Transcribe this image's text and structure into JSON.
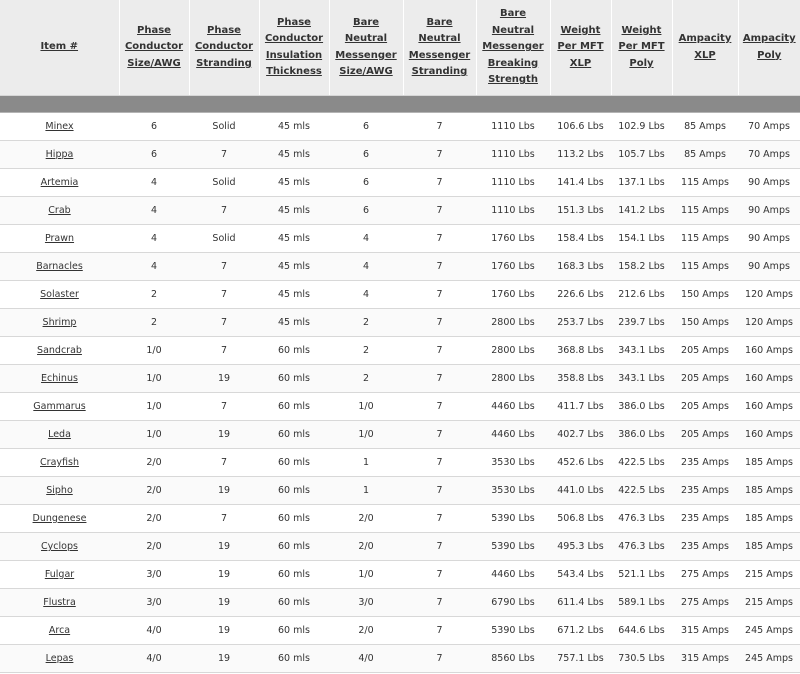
{
  "headers": [
    {
      "key": "item",
      "label": "Item #"
    },
    {
      "key": "p_size",
      "label": "Phase Conductor Size/AWG"
    },
    {
      "key": "p_strand",
      "label": "Phase Conductor Stranding"
    },
    {
      "key": "p_ins",
      "label": "Phase Conductor Insulation Thickness"
    },
    {
      "key": "n_size",
      "label": "Bare Neutral Messenger Size/AWG"
    },
    {
      "key": "n_strand",
      "label": "Bare Neutral Messenger Stranding"
    },
    {
      "key": "n_break",
      "label": "Bare Neutral Messenger Breaking Strength"
    },
    {
      "key": "w_xlp",
      "label": "Weight Per MFT XLP"
    },
    {
      "key": "w_poly",
      "label": "Weight Per MFT Poly"
    },
    {
      "key": "a_xlp",
      "label": "Ampacity XLP"
    },
    {
      "key": "a_poly",
      "label": "Ampacity Poly"
    }
  ],
  "rows": [
    [
      "Minex",
      "6",
      "Solid",
      "45 mls",
      "6",
      "7",
      "1110 Lbs",
      "106.6 Lbs",
      "102.9 Lbs",
      "85 Amps",
      "70 Amps"
    ],
    [
      "Hippa",
      "6",
      "7",
      "45 mls",
      "6",
      "7",
      "1110 Lbs",
      "113.2 Lbs",
      "105.7 Lbs",
      "85 Amps",
      "70 Amps"
    ],
    [
      "Artemia",
      "4",
      "Solid",
      "45 mls",
      "6",
      "7",
      "1110 Lbs",
      "141.4 Lbs",
      "137.1 Lbs",
      "115 Amps",
      "90 Amps"
    ],
    [
      "Crab",
      "4",
      "7",
      "45 mls",
      "6",
      "7",
      "1110 Lbs",
      "151.3 Lbs",
      "141.2 Lbs",
      "115 Amps",
      "90 Amps"
    ],
    [
      "Prawn",
      "4",
      "Solid",
      "45 mls",
      "4",
      "7",
      "1760 Lbs",
      "158.4 Lbs",
      "154.1 Lbs",
      "115 Amps",
      "90 Amps"
    ],
    [
      "Barnacles",
      "4",
      "7",
      "45 mls",
      "4",
      "7",
      "1760 Lbs",
      "168.3 Lbs",
      "158.2 Lbs",
      "115 Amps",
      "90 Amps"
    ],
    [
      "Solaster",
      "2",
      "7",
      "45 mls",
      "4",
      "7",
      "1760 Lbs",
      "226.6 Lbs",
      "212.6 Lbs",
      "150 Amps",
      "120 Amps"
    ],
    [
      "Shrimp",
      "2",
      "7",
      "45 mls",
      "2",
      "7",
      "2800 Lbs",
      "253.7 Lbs",
      "239.7 Lbs",
      "150 Amps",
      "120 Amps"
    ],
    [
      "Sandcrab",
      "1/0",
      "7",
      "60 mls",
      "2",
      "7",
      "2800 Lbs",
      "368.8 Lbs",
      "343.1 Lbs",
      "205 Amps",
      "160 Amps"
    ],
    [
      "Echinus",
      "1/0",
      "19",
      "60 mls",
      "2",
      "7",
      "2800 Lbs",
      "358.8 Lbs",
      "343.1 Lbs",
      "205 Amps",
      "160 Amps"
    ],
    [
      "Gammarus",
      "1/0",
      "7",
      "60 mls",
      "1/0",
      "7",
      "4460 Lbs",
      "411.7 Lbs",
      "386.0 Lbs",
      "205 Amps",
      "160 Amps"
    ],
    [
      "Leda",
      "1/0",
      "19",
      "60 mls",
      "1/0",
      "7",
      "4460 Lbs",
      "402.7 Lbs",
      "386.0 Lbs",
      "205 Amps",
      "160 Amps"
    ],
    [
      "Crayfish",
      "2/0",
      "7",
      "60 mls",
      "1",
      "7",
      "3530 Lbs",
      "452.6 Lbs",
      "422.5 Lbs",
      "235 Amps",
      "185 Amps"
    ],
    [
      "Sipho",
      "2/0",
      "19",
      "60 mls",
      "1",
      "7",
      "3530 Lbs",
      "441.0 Lbs",
      "422.5 Lbs",
      "235 Amps",
      "185 Amps"
    ],
    [
      "Dungenese",
      "2/0",
      "7",
      "60 mls",
      "2/0",
      "7",
      "5390 Lbs",
      "506.8 Lbs",
      "476.3 Lbs",
      "235 Amps",
      "185 Amps"
    ],
    [
      "Cyclops",
      "2/0",
      "19",
      "60 mls",
      "2/0",
      "7",
      "5390 Lbs",
      "495.3 Lbs",
      "476.3 Lbs",
      "235 Amps",
      "185 Amps"
    ],
    [
      "Fulgar",
      "3/0",
      "19",
      "60 mls",
      "1/0",
      "7",
      "4460 Lbs",
      "543.4 Lbs",
      "521.1 Lbs",
      "275 Amps",
      "215 Amps"
    ],
    [
      "Flustra",
      "3/0",
      "19",
      "60 mls",
      "3/0",
      "7",
      "6790 Lbs",
      "611.4 Lbs",
      "589.1 Lbs",
      "275 Amps",
      "215 Amps"
    ],
    [
      "Arca",
      "4/0",
      "19",
      "60 mls",
      "2/0",
      "7",
      "5390 Lbs",
      "671.2 Lbs",
      "644.6 Lbs",
      "315 Amps",
      "245 Amps"
    ],
    [
      "Lepas",
      "4/0",
      "19",
      "60 mls",
      "4/0",
      "7",
      "8560 Lbs",
      "757.1 Lbs",
      "730.5 Lbs",
      "315 Amps",
      "245 Amps"
    ]
  ]
}
